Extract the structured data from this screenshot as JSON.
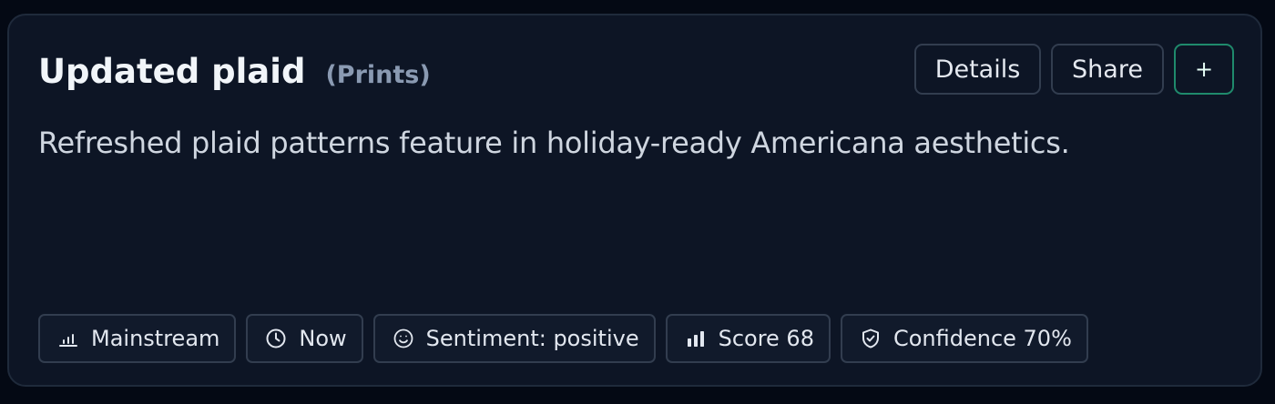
{
  "card": {
    "title": "Updated plaid",
    "category": "(Prints)",
    "description": "Refreshed plaid patterns feature in holiday-ready Americana aesthetics."
  },
  "actions": {
    "details_label": "Details",
    "share_label": "Share",
    "add_label": "+"
  },
  "tags": {
    "reach": {
      "label": "Mainstream",
      "icon": "bar-chart-low-icon"
    },
    "timing": {
      "label": "Now",
      "icon": "clock-icon"
    },
    "sentiment": {
      "label": "Sentiment: positive",
      "icon": "smiley-icon"
    },
    "score": {
      "label": "Score 68",
      "icon": "bar-chart-icon"
    },
    "confidence": {
      "label": "Confidence 70%",
      "icon": "shield-check-icon"
    }
  },
  "colors": {
    "background": "#040914",
    "card": "#0d1525",
    "border": "#323d4f",
    "accent": "#1f8a6c",
    "muted_text": "#8a9ab2"
  }
}
